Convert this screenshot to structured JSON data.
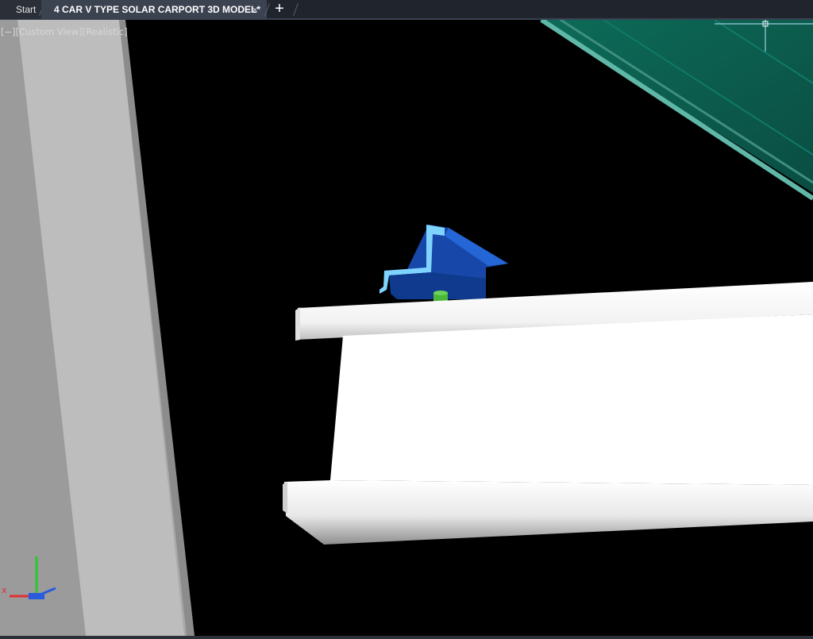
{
  "tabs": {
    "start_label": "Start",
    "doc_label": "4 CAR V TYPE SOLAR CARPORT 3D MODEL*",
    "close_glyph": "×",
    "new_glyph": "+"
  },
  "viewport": {
    "controls": {
      "minus": "[−]",
      "view": "[Custom View]",
      "style": "[Realistic]"
    }
  },
  "icons": {
    "ucs": "ucs-axis-icon",
    "viewcube": "viewcube-corner-icon"
  },
  "colors": {
    "tab_bar": "#20242c",
    "active_tab": "#3b4250",
    "viewport_bg": "#000000",
    "panel_teal": "#0b5a4c",
    "purlin": "#ffffff",
    "clamp_blue": "#1a4fb8",
    "clamp_edge": "#7fd4ff",
    "bolt_green": "#3aa829",
    "column_grey": "#b4b4b4"
  }
}
